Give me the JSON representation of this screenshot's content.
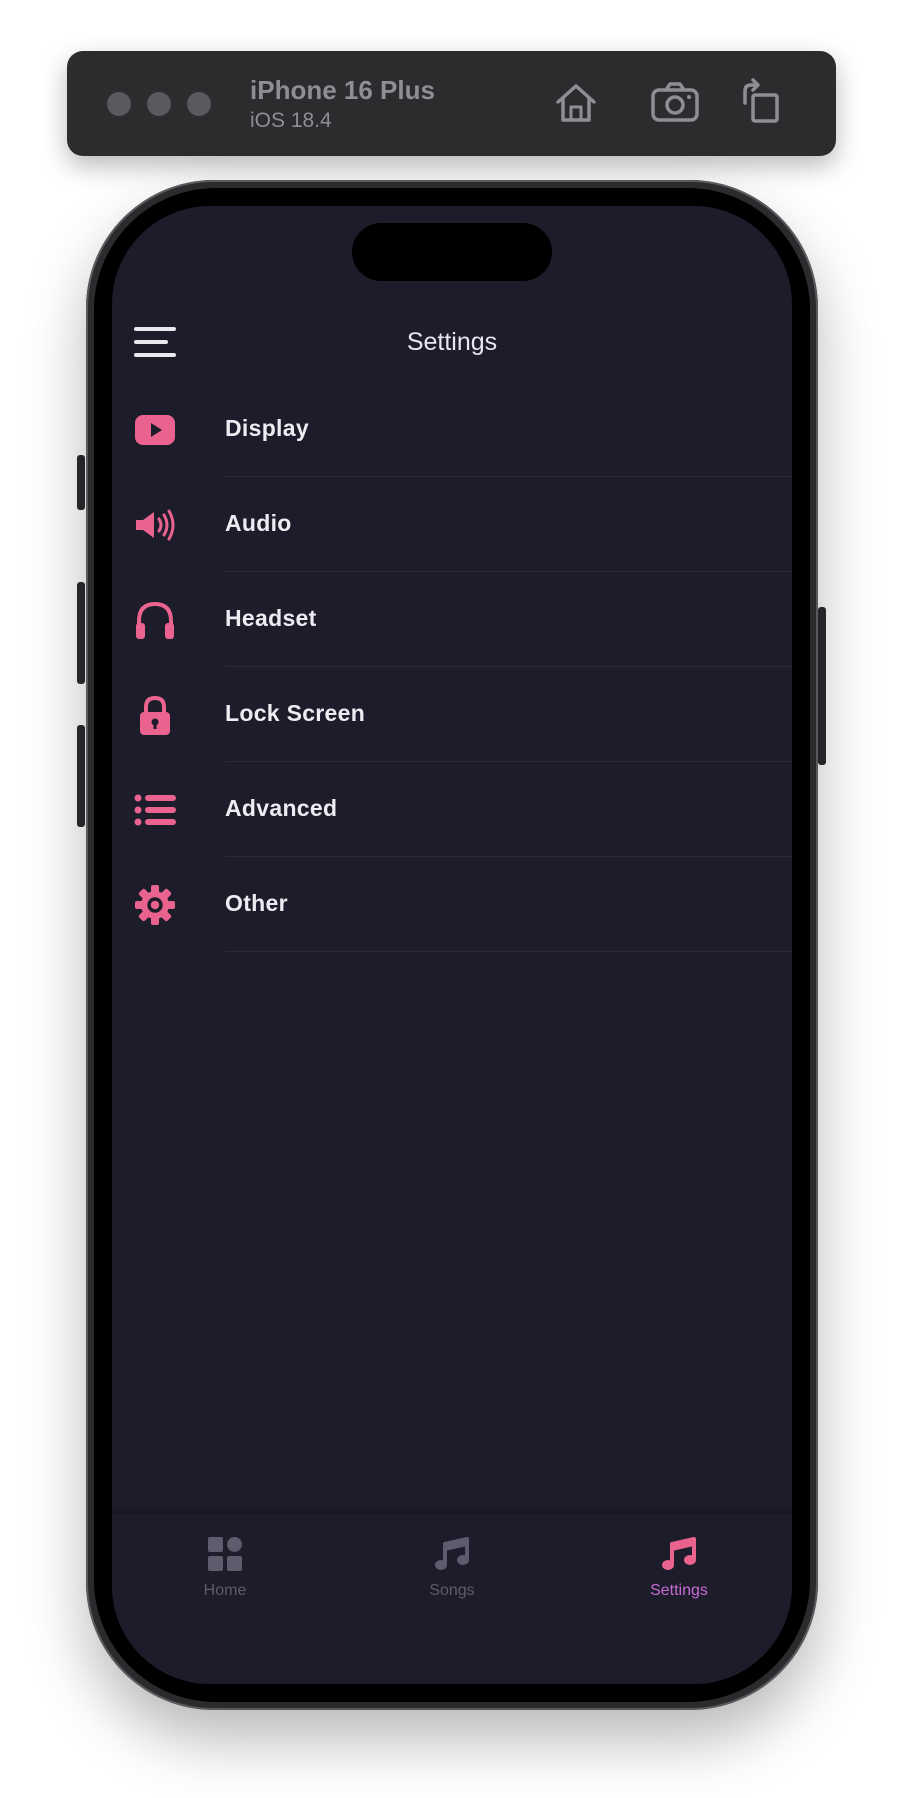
{
  "simulator": {
    "device_name": "iPhone 16 Plus",
    "os_version": "iOS 18.4",
    "toolbar_icons": [
      "home-icon",
      "screenshot-icon",
      "rotate-icon"
    ]
  },
  "screen": {
    "title": "Settings",
    "menu_icon": "hamburger-menu-icon",
    "accent_color": "#e9638e",
    "background_color": "#1c1c2b",
    "items": [
      {
        "label": "Display",
        "icon": "play-icon"
      },
      {
        "label": "Audio",
        "icon": "speaker-icon"
      },
      {
        "label": "Headset",
        "icon": "headphones-icon"
      },
      {
        "label": "Lock Screen",
        "icon": "lock-icon"
      },
      {
        "label": "Advanced",
        "icon": "list-icon"
      },
      {
        "label": "Other",
        "icon": "gear-icon"
      }
    ]
  },
  "tabbar": {
    "active_tab": "Settings",
    "active_color": "#c86ad3",
    "tabs": [
      {
        "label": "Home",
        "icon": "grid-icon"
      },
      {
        "label": "Songs",
        "icon": "music-note-icon"
      },
      {
        "label": "Settings",
        "icon": "music-note-icon"
      }
    ]
  }
}
